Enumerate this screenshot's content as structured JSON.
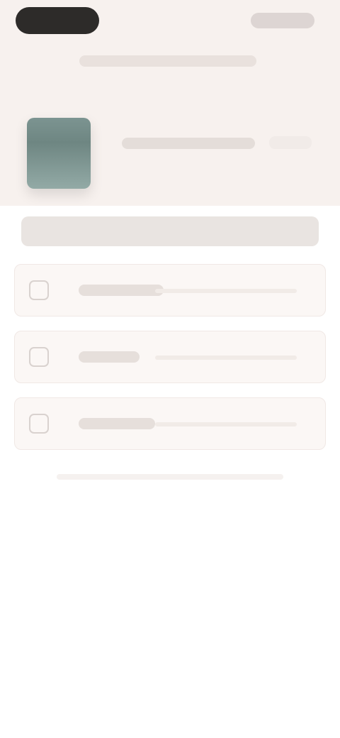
{
  "icons": {
    "top_pill": "pill-button-icon",
    "option_1": "checkbox-icon",
    "option_2": "checkbox-icon",
    "option_3": "checkbox-icon"
  },
  "colors": {
    "background": "#ffffff",
    "hero_background": "#f7f1ee",
    "dark_pill": "#2d2b29",
    "thumbnail": "#7c9491",
    "placeholder": "#e6dfdb",
    "option_background": "#fbf7f5"
  }
}
